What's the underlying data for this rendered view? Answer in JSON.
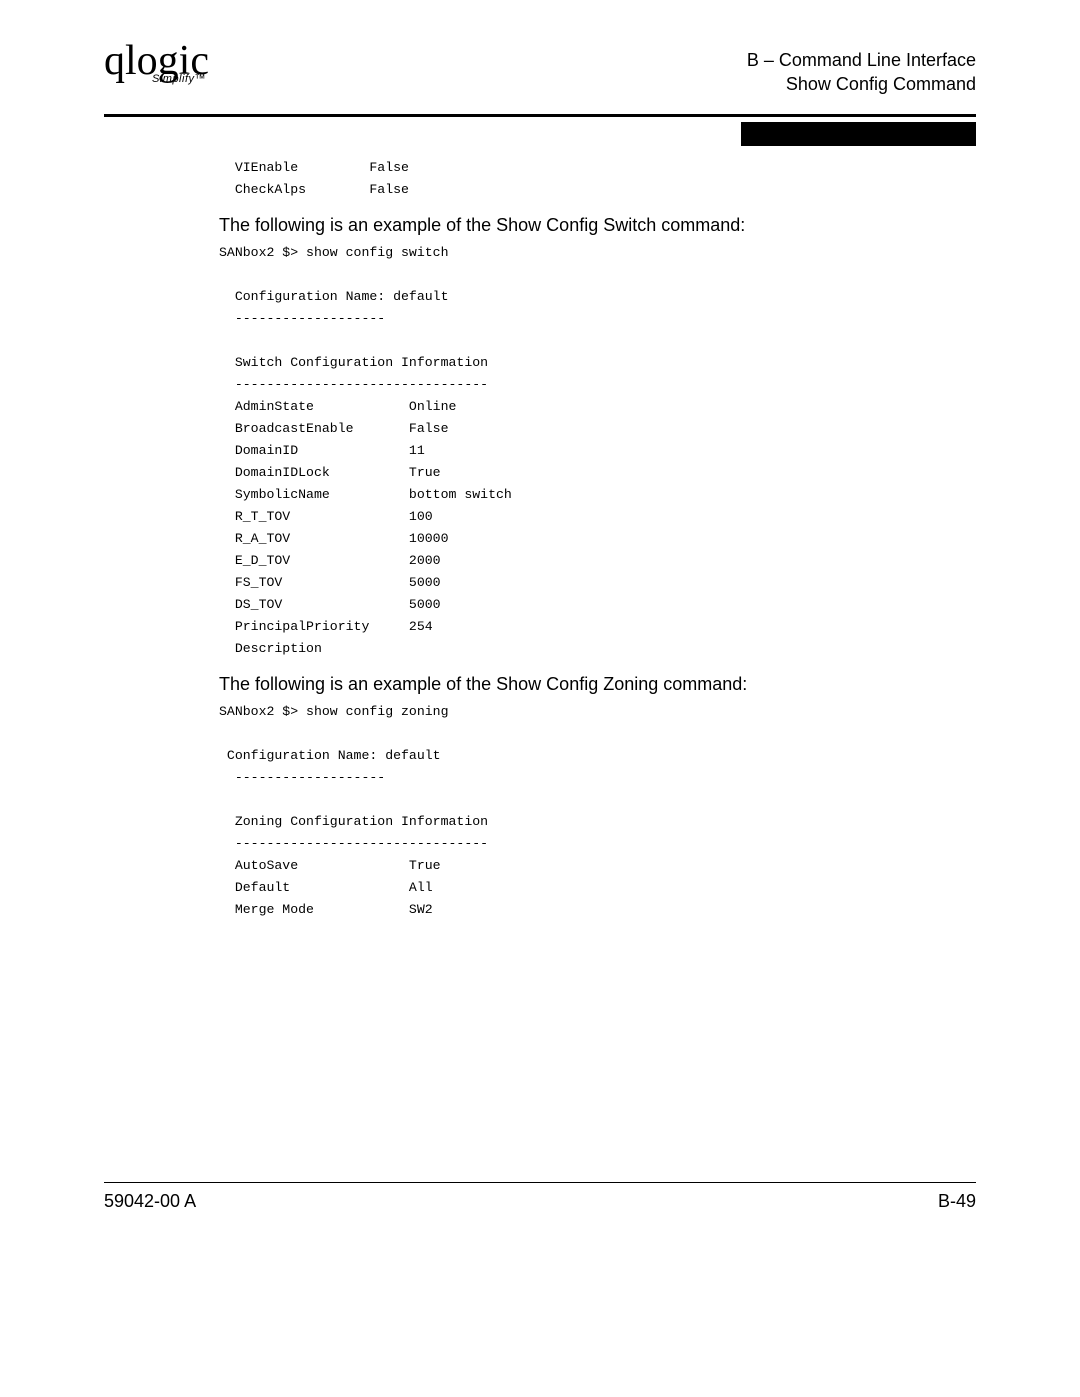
{
  "header": {
    "logo_main": "qlogic",
    "logo_sub": "Simplify™",
    "right_line1": "B – Command Line Interface",
    "right_line2": "Show Config Command"
  },
  "pre_intro": "  VIEnable         False\n  CheckAlps        False",
  "text_switch": "The following is an example of the Show Config Switch command:",
  "pre_switch": "SANbox2 $> show config switch\n\n  Configuration Name: default\n  -------------------\n\n  Switch Configuration Information\n  --------------------------------\n  AdminState            Online\n  BroadcastEnable       False\n  DomainID              11\n  DomainIDLock          True\n  SymbolicName          bottom switch\n  R_T_TOV               100\n  R_A_TOV               10000\n  E_D_TOV               2000\n  FS_TOV                5000\n  DS_TOV                5000\n  PrincipalPriority     254\n  Description",
  "text_zoning": "The following is an example of the Show Config Zoning command:",
  "pre_zoning": "SANbox2 $> show config zoning\n\n Configuration Name: default\n  -------------------\n\n  Zoning Configuration Information\n  --------------------------------\n  AutoSave              True\n  Default               All\n  Merge Mode            SW2",
  "footer": {
    "left": "59042-00  A",
    "right": "B-49"
  }
}
